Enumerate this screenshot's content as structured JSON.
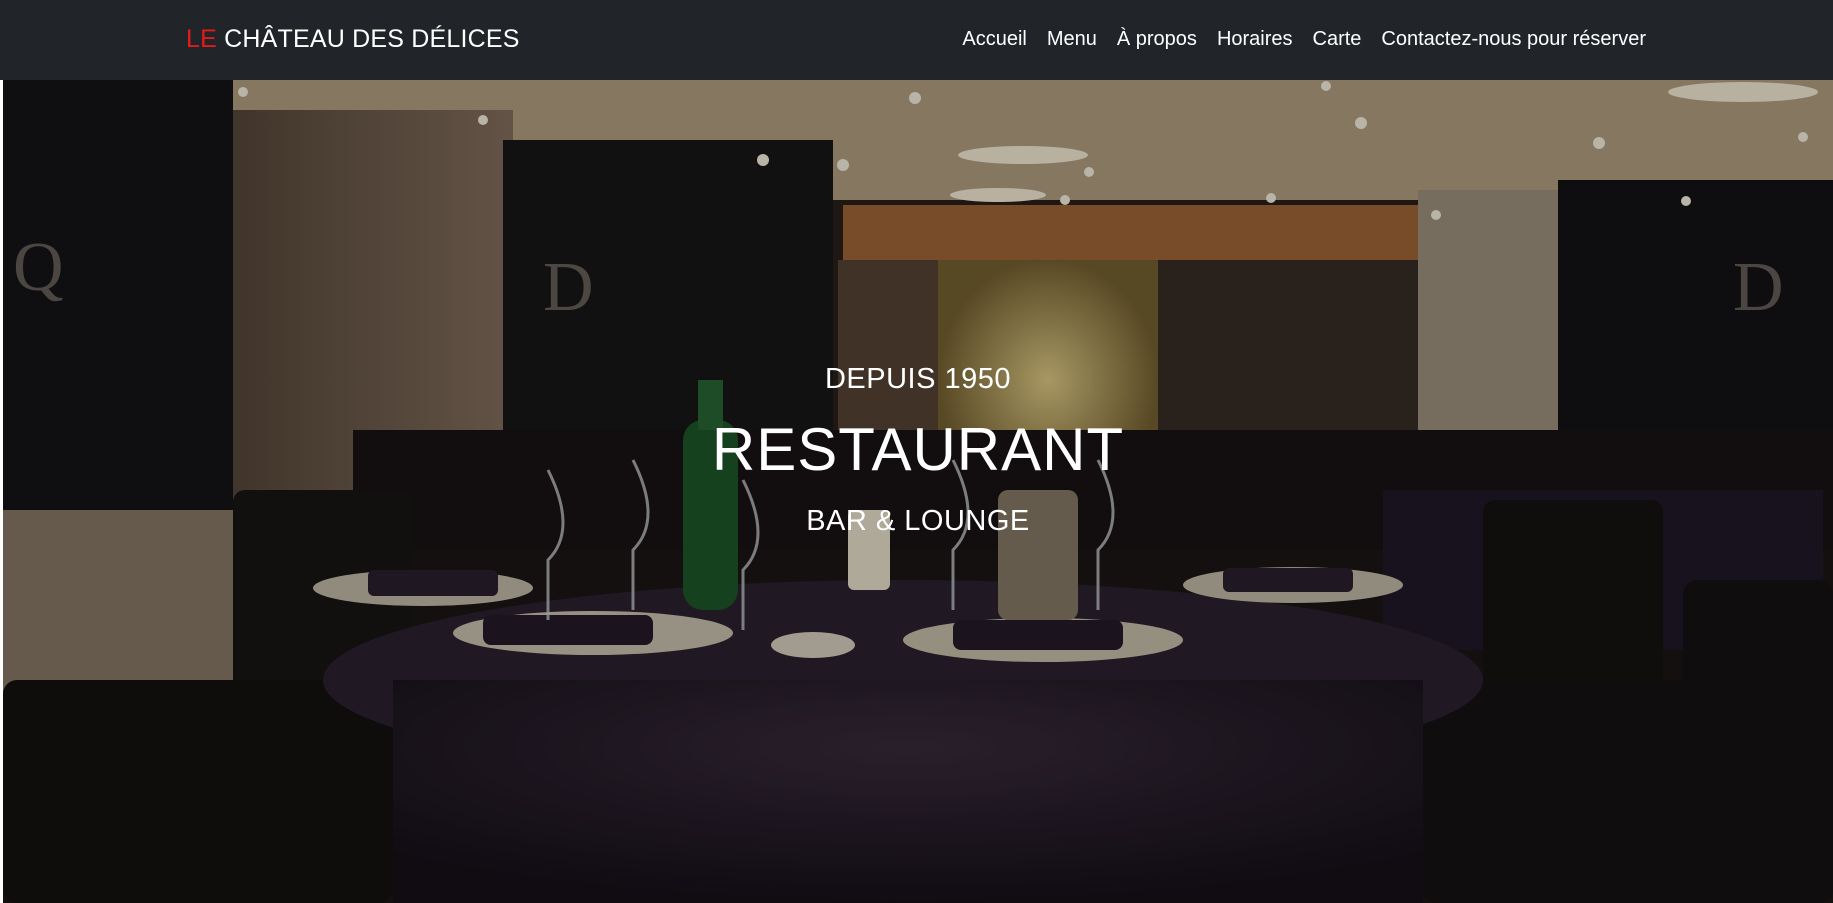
{
  "navbar": {
    "brand_accent": "LE",
    "brand_rest": " CHÂTEAU DES DÉLICES",
    "links": [
      {
        "label": "Accueil"
      },
      {
        "label": "Menu"
      },
      {
        "label": "À propos"
      },
      {
        "label": "Horaires"
      },
      {
        "label": "Carte"
      },
      {
        "label": "Contactez-nous pour réserver"
      }
    ]
  },
  "hero": {
    "eyebrow": "DEPUIS 1950",
    "title": "RESTAURANT",
    "subtitle": "BAR & LOUNGE"
  },
  "colors": {
    "navbar_bg": "#212428",
    "brand_accent": "#e21b1b",
    "text": "#ffffff"
  }
}
